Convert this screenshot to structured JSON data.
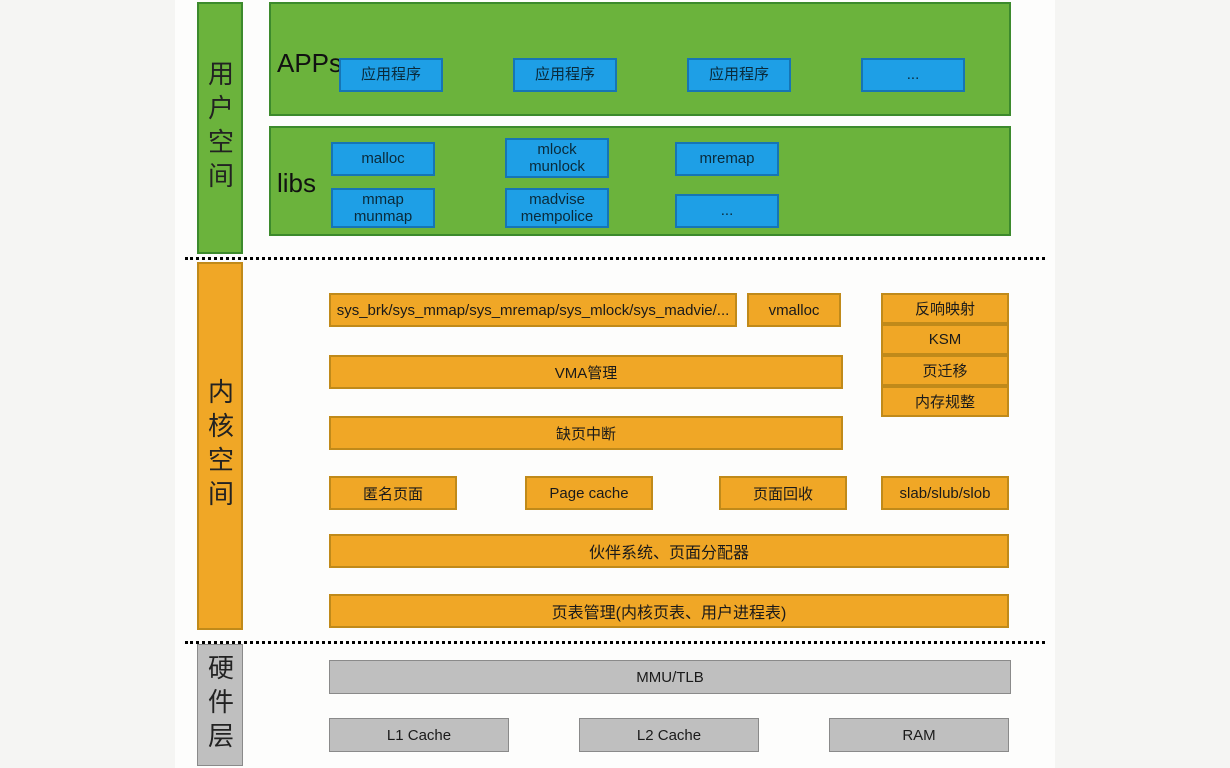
{
  "layers": {
    "user": "用户空间",
    "kernel": "内核空间",
    "hardware": "硬件层"
  },
  "apps": {
    "title": "APPs",
    "items": [
      "应用程序",
      "应用程序",
      "应用程序",
      "..."
    ]
  },
  "libs": {
    "title": "libs",
    "row1": [
      {
        "lines": [
          "malloc"
        ]
      },
      {
        "lines": [
          "mlock",
          "munlock"
        ]
      },
      {
        "lines": [
          "mremap"
        ]
      }
    ],
    "row2": [
      {
        "lines": [
          "mmap",
          "munmap"
        ]
      },
      {
        "lines": [
          "madvise",
          "mempolice"
        ]
      },
      {
        "lines": [
          "..."
        ]
      }
    ]
  },
  "kernel": {
    "top_row": {
      "syscalls": "sys_brk/sys_mmap/sys_mremap/sys_mlock/sys_madvie/...",
      "vmalloc": "vmalloc"
    },
    "side_stack": [
      "反响映射",
      "KSM",
      "页迁移",
      "内存规整"
    ],
    "vma": "VMA管理",
    "fault": "缺页中断",
    "mid_row": [
      "匿名页面",
      "Page cache",
      "页面回收",
      "slab/slub/slob"
    ],
    "buddy": "伙伴系统、页面分配器",
    "pagetable": "页表管理(内核页表、用户进程表)"
  },
  "hardware": {
    "mmu": "MMU/TLB",
    "blocks": [
      "L1 Cache",
      "L2 Cache",
      "RAM"
    ]
  }
}
